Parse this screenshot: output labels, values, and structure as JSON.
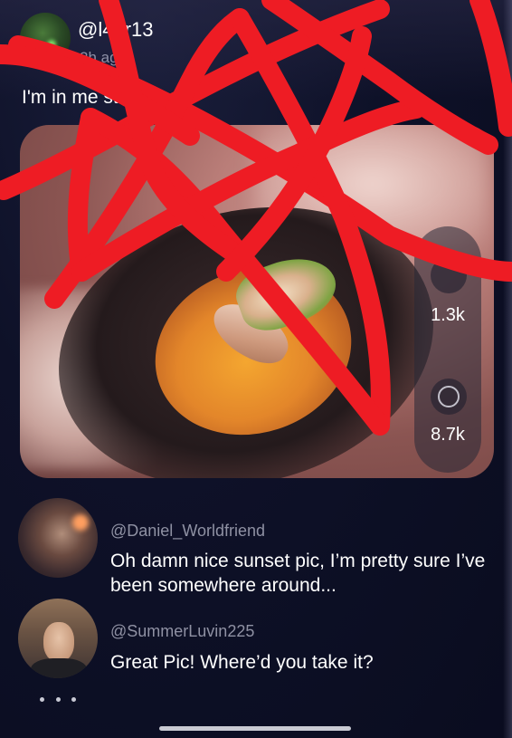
{
  "post": {
    "username": "@l4ur13",
    "timestamp": "2h ago",
    "caption": "I'm in me  stew",
    "photo_subject": "stew in dark bowl",
    "like_count": "1.3k",
    "comment_count": "8.7k"
  },
  "comments": [
    {
      "handle": "@Daniel_Worldfriend",
      "text": "Oh damn nice sunset pic, I’m pretty sure I’ve been somewhere around..."
    },
    {
      "handle": "@SummerLuvin225",
      "text": "Great Pic! Where’d you take it?"
    }
  ],
  "icons": {
    "like": "heart-icon",
    "comment": "comment-icon",
    "more": "more-dots-icon"
  },
  "colors": {
    "background": "#0d1024",
    "scribble": "#ee1c24",
    "muted_text": "#8f91a3"
  }
}
